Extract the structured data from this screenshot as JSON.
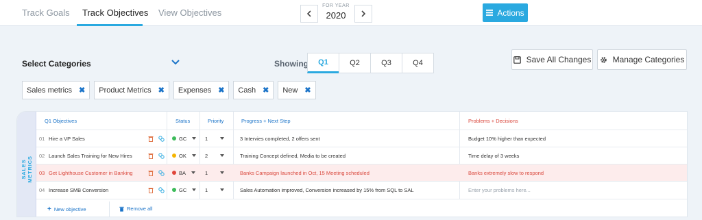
{
  "nav": {
    "tabs": [
      {
        "label": "Track Goals",
        "active": false
      },
      {
        "label": "Track Objectives",
        "active": true
      },
      {
        "label": "View Objectives",
        "active": false
      }
    ],
    "year_caption": "FOR YEAR",
    "year": "2020",
    "actions_label": "Actions"
  },
  "filters": {
    "select_categories": "Select Categories",
    "showing_label": "Showing",
    "quarters": [
      "Q1",
      "Q2",
      "Q3",
      "Q4"
    ],
    "active_quarter": "Q1",
    "save_label": "Save All Changes",
    "manage_label": "Manage Categories",
    "chips": [
      "Sales metrics",
      "Product Metrics",
      "Expenses",
      "Cash",
      "New"
    ]
  },
  "table": {
    "side_label_1": "SALES",
    "side_label_2": "METRICS",
    "headers": {
      "objectives": "Q1 Objectives",
      "status": "Status",
      "priority": "Priority",
      "progress": "Progress + Next Step",
      "problems": "Problems + Decisions"
    },
    "rows": [
      {
        "num": "01",
        "objective": "Hire a VP Sales",
        "status": "GC",
        "status_color": "#3dbb5a",
        "priority": "1",
        "progress": "3 Intervies completed, 2 offers sent",
        "problems": "Budget 10% higher than expected"
      },
      {
        "num": "02",
        "objective": "Launch Sales Training for New Hires",
        "status": "OK",
        "status_color": "#f5b400",
        "priority": "2",
        "progress": "Training Concept defined, Media to be created",
        "problems": "Time delay of 3 weeks"
      },
      {
        "num": "03",
        "objective": "Get Lighthouse Customer in Banking",
        "status": "BA",
        "status_color": "#e0453a",
        "priority": "1",
        "progress": "Banks Campaign launched in Oct, 15 Meeting scheduled",
        "problems": "Banks extremely slow to respond"
      },
      {
        "num": "04",
        "objective": "Increase SMB Conversion",
        "status": "GC",
        "status_color": "#3dbb5a",
        "priority": "1",
        "progress": "Sales Automation improved, Conversion increased by 15% from SQL to SAL",
        "problems": ""
      }
    ],
    "problems_placeholder": "Enter your problems here...",
    "new_objective": "New objective",
    "remove_all": "Remove all"
  },
  "colors": {
    "accent": "#2aa9e0",
    "link": "#1a73c8",
    "alert": "#d9463b"
  }
}
